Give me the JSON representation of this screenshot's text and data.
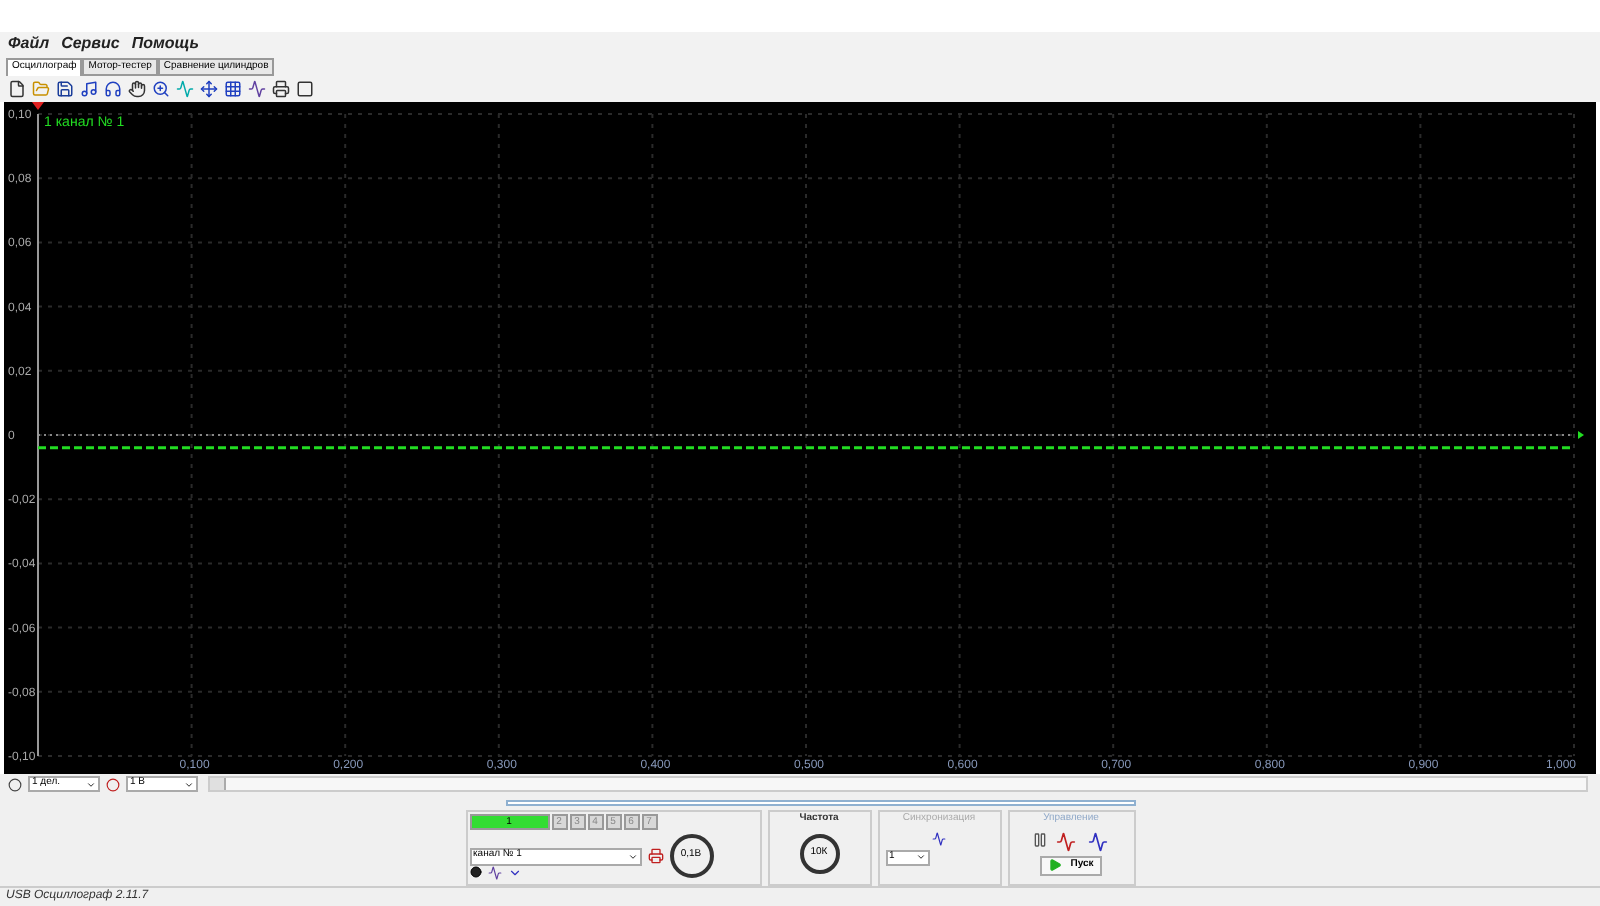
{
  "menu": [
    "Файл",
    "Сервис",
    "Помощь"
  ],
  "tabs": [
    {
      "label": "Осциллограф",
      "selected": true
    },
    {
      "label": "Мотор-тестер",
      "selected": false
    },
    {
      "label": "Сравнение цилиндров",
      "selected": false
    }
  ],
  "plot": {
    "channel_label": "1",
    "chart_data": {
      "type": "line",
      "grid": true,
      "ref_lines": [
        {
          "axis": "y",
          "value": 0,
          "color": "#888888"
        }
      ],
      "x": [
        0,
        1
      ],
      "series": [
        {
          "name": "канал № 1",
          "color": "#22dd22",
          "line_style": "dashed",
          "values": [
            -0.004,
            -0.004
          ]
        }
      ],
      "xlim": [
        0,
        1
      ],
      "ylim": [
        -0.1,
        0.1
      ],
      "xticks": [
        {
          "value": 0.1,
          "label": "0,100"
        },
        {
          "value": 0.2,
          "label": "0,200"
        },
        {
          "value": 0.3,
          "label": "0,300"
        },
        {
          "value": 0.4,
          "label": "0,400"
        },
        {
          "value": 0.5,
          "label": "0,500"
        },
        {
          "value": 0.6,
          "label": "0,600"
        },
        {
          "value": 0.7,
          "label": "0,700"
        },
        {
          "value": 0.8,
          "label": "0,800"
        },
        {
          "value": 0.9,
          "label": "0,900"
        },
        {
          "value": 1,
          "label": "1,000"
        }
      ],
      "yticks": [
        {
          "value": 0.1,
          "label": "0,10"
        },
        {
          "value": 0.08,
          "label": "0,08"
        },
        {
          "value": 0.06,
          "label": "0,06"
        },
        {
          "value": 0.04,
          "label": "0,04"
        },
        {
          "value": 0.02,
          "label": "0,02"
        },
        {
          "value": 0,
          "label": "0"
        },
        {
          "value": -0.02,
          "label": "-0,02"
        },
        {
          "value": -0.04,
          "label": "-0,04"
        },
        {
          "value": -0.06,
          "label": "-0,06"
        },
        {
          "value": -0.08,
          "label": "-0,08"
        },
        {
          "value": -0.1,
          "label": "-0,10"
        }
      ]
    }
  },
  "scale": {
    "time_div": "1 дел.",
    "volt_div": "1 В"
  },
  "channel_tabs": [
    {
      "label": "1",
      "selected": true
    },
    {
      "label": "2",
      "selected": false
    },
    {
      "label": "3",
      "selected": false
    },
    {
      "label": "4",
      "selected": false
    },
    {
      "label": "5",
      "selected": false
    },
    {
      "label": "6",
      "selected": false
    },
    {
      "label": "7",
      "selected": false
    }
  ],
  "channel_select": "канал № 1",
  "volt_knob": "0,1В",
  "frequency": {
    "title": "Частота",
    "knob": "10К"
  },
  "sync": {
    "title": "Синхронизация",
    "source": "1"
  },
  "control": {
    "title": "Управление",
    "start": "Пуск"
  },
  "status_bar": "USB Осциллограф 2.11.7"
}
